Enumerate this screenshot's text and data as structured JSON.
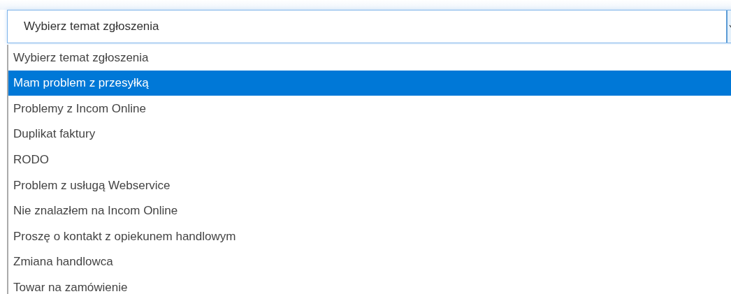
{
  "select": {
    "value": "Wybierz temat zgłoszenia"
  },
  "options": [
    {
      "label": "Wybierz temat zgłoszenia",
      "selected": false
    },
    {
      "label": "Mam problem z przesyłką",
      "selected": true
    },
    {
      "label": "Problemy z Incom Online",
      "selected": false
    },
    {
      "label": "Duplikat faktury",
      "selected": false
    },
    {
      "label": "RODO",
      "selected": false
    },
    {
      "label": "Problem z usługą Webservice",
      "selected": false
    },
    {
      "label": "Nie znalazłem na Incom Online",
      "selected": false
    },
    {
      "label": "Proszę o kontakt z opiekunem handlowym",
      "selected": false
    },
    {
      "label": "Zmiana handlowca",
      "selected": false
    },
    {
      "label": "Towar na zamówienie",
      "selected": false
    }
  ]
}
